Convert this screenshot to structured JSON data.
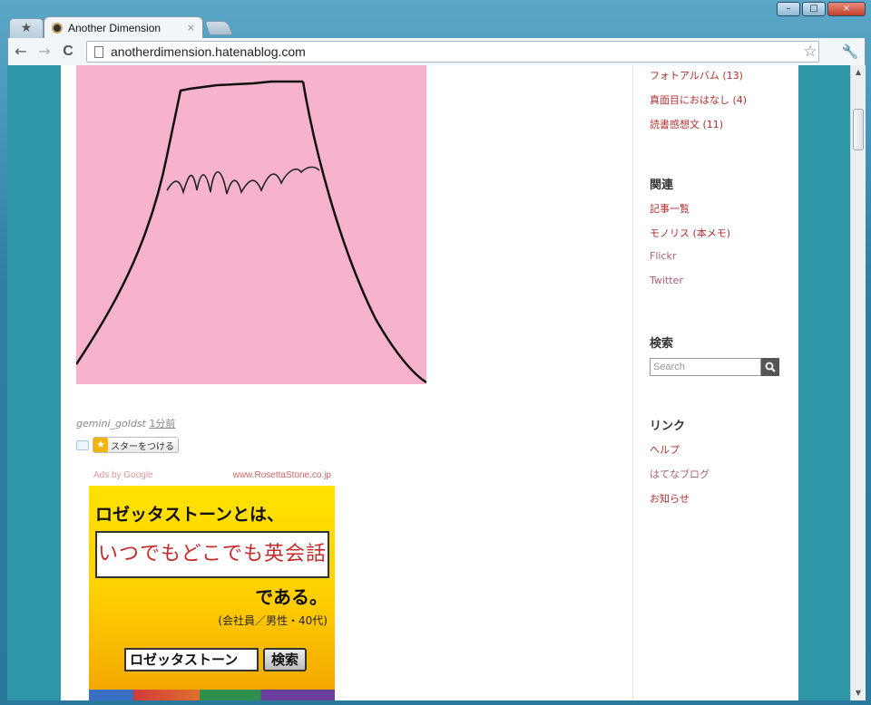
{
  "browser": {
    "tab_title": "Another Dimension",
    "tab_close": "×",
    "url": "anotherdimension.hatenablog.com",
    "back": "←",
    "forward": "→",
    "reload": "C",
    "wm_minimize": "–",
    "wm_maximize": "□",
    "wm_close": "×"
  },
  "post": {
    "author": "gemini_goldst",
    "time": "1分前",
    "star_label": "スターをつける",
    "star_icon": "★"
  },
  "ad": {
    "ads_by": "Ads by Google",
    "domain": "www.RosettaStone.co.jp",
    "headline": "ロゼッタストーンとは、",
    "tagline": "いつでもどこでも英会話",
    "desu": "である。",
    "sub": "(会社員／男性・40代)",
    "input_value": "ロゼッタストーン",
    "search_label": "検索"
  },
  "sidebar": {
    "categories": [
      {
        "label": "フォトアルバム (13)"
      },
      {
        "label": "真面目におはなし (4)"
      },
      {
        "label": "読書感想文 (11)"
      }
    ],
    "related_title": "関連",
    "related": [
      {
        "label": "記事一覧"
      },
      {
        "label": "モノリス (本メモ)"
      },
      {
        "label": "Flickr"
      },
      {
        "label": "Twitter"
      }
    ],
    "search_title": "検索",
    "search_placeholder": "Search",
    "links_title": "リンク",
    "links": [
      {
        "label": "ヘルプ"
      },
      {
        "label": "はてなブログ"
      },
      {
        "label": "お知らせ"
      }
    ]
  },
  "colors": {
    "page_bg": "#2e96a6",
    "link": "#b23030",
    "photo_bg": "#f7b3cd",
    "ad_yellow": "#ffd000"
  }
}
